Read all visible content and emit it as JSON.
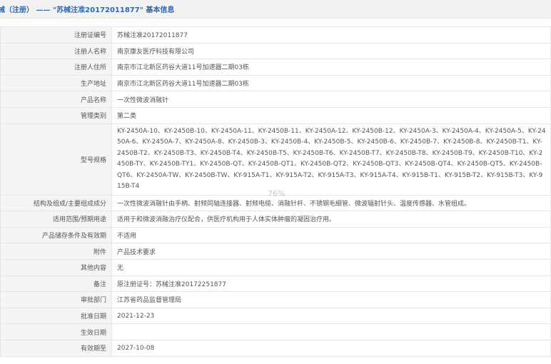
{
  "header": {
    "title": "械（注册） —— \"苏械注准20172011877\" 基本信息"
  },
  "rows": [
    {
      "label": "注册证编号",
      "value": "苏械注准20172011877"
    },
    {
      "label": "注册人名称",
      "value": "南京康友医疗科技有限公司"
    },
    {
      "label": "注册人住所",
      "value": "南京市江北新区药谷大道11号加速器二期03栋"
    },
    {
      "label": "生产地址",
      "value": "南京市江北新区药谷大道11号加速器二期03栋"
    },
    {
      "label": "产品名称",
      "value": "一次性微波消融针"
    },
    {
      "label": "管理类别",
      "value": "第二类"
    },
    {
      "label": "型号规格",
      "value": "KY-2450A-10、KY-2450B-10、KY-2450A-11、KY-2450B-11、KY-2450A-12、KY-2450B-12、KY-2450A-3、KY-2450A-4、KY-2450A-5、KY-2450A-6、KY-2450A-7、KY-2450A-8、KY-2450B-3、KY-2450B-4、KY-2450B-5、KY-2450B-6、KY-2450B-7、KY-2450B-8、KY-2450B-T1、KY-2450B-T2、KY-2450B-T3、KY-2450B-T4、KY-2450B-T5、KY-2450B-T6、KY-2450B-T7、KY-2450B-T8、KY-2450B-T9、KY-2450B-T10、KY-2450B-TY、KY-2450B-TY1、KY-2450B-QT、KY-2450B-QT1、KY-2450B-QT2、KY-2450B-QT3、KY-2450B-QT4、KY-2450B-QT5、KY-2450B-QT6、KY-2450A-TW、KY-2450B-TW、KY-915A-T1、KY-915A-T2、KY-915A-T3、KY-915A-T4、KY-915B-T1、KY-915B-T2、KY-915B-T3、KY-915B-T4"
    },
    {
      "label": "结构及组成/主要组成成分",
      "value": "一次性微波消融针由手柄、射频同轴连接器、射频电缆、消融针杆、不锈钢毛细管、微波辐射针头、温度传感器、水管组成。"
    },
    {
      "label": "适用范围/预期用途",
      "value": "适用于和微波消融治疗仪配合，供医疗机构用于人体实体肿瘤的凝固治疗用。"
    },
    {
      "label": "产品储存条件及有效期",
      "value": "不适用"
    },
    {
      "label": "附件",
      "value": "产品技术要求"
    },
    {
      "label": "其他内容",
      "value": "无"
    },
    {
      "label": "备注",
      "value": "原注册证号：苏械注准20172251877"
    },
    {
      "label": "审批部门",
      "value": "江苏省药品监督管理局"
    },
    {
      "label": "批准日期",
      "value": "2021-12-23"
    },
    {
      "label": "生效日期",
      "value": ""
    },
    {
      "label": "有效期至",
      "value": "2027-10-08"
    }
  ],
  "zoom": {
    "level": "76%"
  }
}
